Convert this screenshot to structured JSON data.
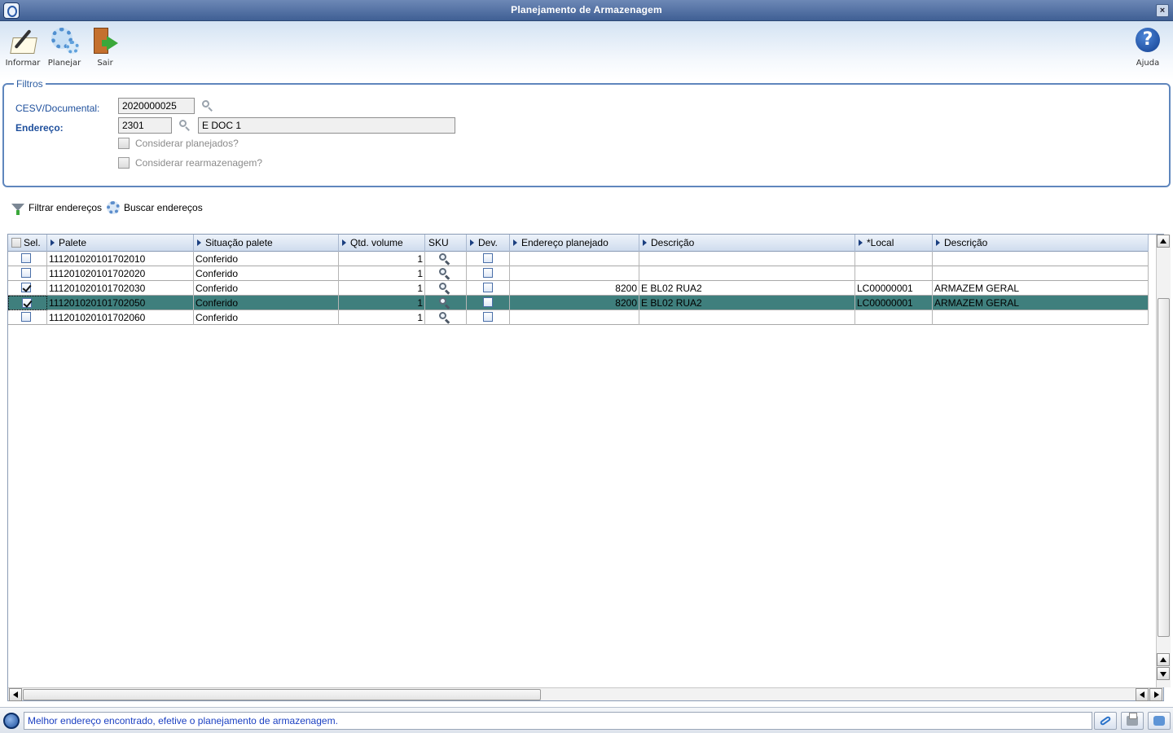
{
  "window": {
    "title": "Planejamento de Armazenagem"
  },
  "toolbar": {
    "informar": "Informar",
    "planejar": "Planejar",
    "sair": "Sair",
    "ajuda": "Ajuda"
  },
  "filters": {
    "legend": "Filtros",
    "cesv_label": "CESV/Documental:",
    "cesv_value": "2020000025",
    "endereco_label": "Endereço:",
    "endereco_code": "2301",
    "endereco_desc": "E DOC 1",
    "considerar_planejados": "Considerar planejados?",
    "considerar_rearmazenagem": "Considerar rearmazenagem?"
  },
  "actions": {
    "filtrar": "Filtrar endereços",
    "buscar": "Buscar endereços"
  },
  "grid": {
    "headers": {
      "sel": "Sel.",
      "palete": "Palete",
      "situacao": "Situação palete",
      "qtd": "Qtd. volume",
      "sku": "SKU",
      "dev": "Dev.",
      "endereco_planejado": "Endereço planejado",
      "descricao1": "Descrição",
      "local": "*Local",
      "descricao2": "Descrição"
    },
    "rows": [
      {
        "checked": false,
        "palete": "111201020101702010",
        "situacao": "Conferido",
        "qtd": "1",
        "endereco": "",
        "descricao": "",
        "local": "",
        "descricao2": ""
      },
      {
        "checked": false,
        "palete": "111201020101702020",
        "situacao": "Conferido",
        "qtd": "1",
        "endereco": "",
        "descricao": "",
        "local": "",
        "descricao2": ""
      },
      {
        "checked": true,
        "palete": "111201020101702030",
        "situacao": "Conferido",
        "qtd": "1",
        "endereco": "8200",
        "descricao": "E BL02 RUA2",
        "local": "LC00000001",
        "descricao2": "ARMAZEM GERAL"
      },
      {
        "checked": true,
        "palete": "111201020101702050",
        "situacao": "Conferido",
        "qtd": "1",
        "endereco": "8200",
        "descricao": "E BL02 RUA2",
        "local": "LC00000001",
        "descricao2": "ARMAZEM GERAL",
        "selected": true
      },
      {
        "checked": false,
        "palete": "111201020101702060",
        "situacao": "Conferido",
        "qtd": "1",
        "endereco": "",
        "descricao": "",
        "local": "",
        "descricao2": ""
      }
    ]
  },
  "status": {
    "message": "Melhor endereço encontrado, efetive o planejamento de armazenagem."
  },
  "colors": {
    "titlebar": "#3f5f94",
    "selected_row": "#3f7f7d",
    "accent": "#1e4f9c",
    "status_text": "#1a3fc2"
  },
  "icons": [
    "app-icon",
    "close-icon",
    "informar-icon",
    "planejar-icon",
    "sair-icon",
    "ajuda-icon",
    "search-icon",
    "funnel-icon",
    "gear-icon",
    "link-icon",
    "print-icon",
    "chat-icon"
  ]
}
